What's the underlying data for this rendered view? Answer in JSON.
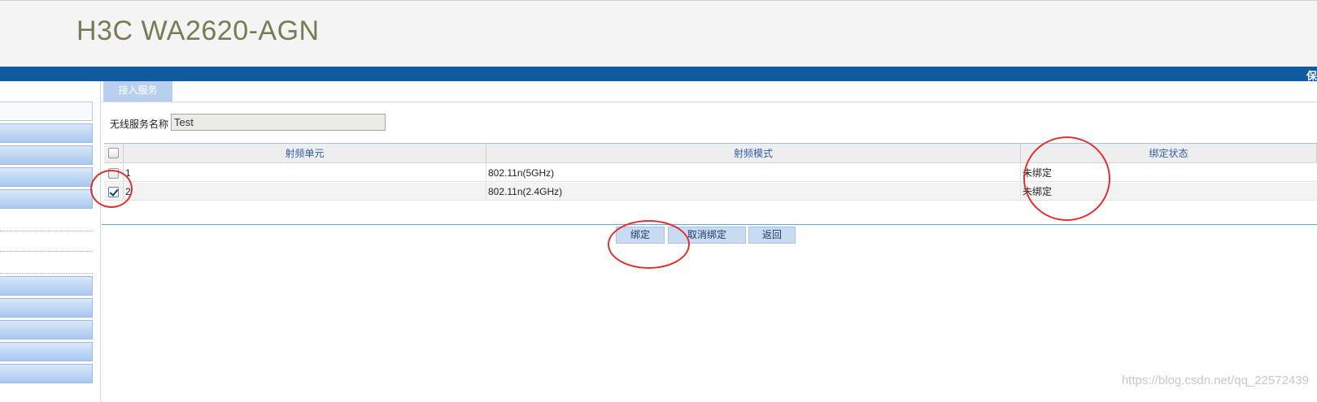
{
  "header": {
    "title": "H3C WA2620-AGN",
    "corner_text": "保"
  },
  "tabs": [
    {
      "label": "接入服务"
    }
  ],
  "service": {
    "label": "无线服务名称",
    "value": "Test"
  },
  "table": {
    "columns": [
      "射频单元",
      "射频模式",
      "绑定状态"
    ],
    "rows": [
      {
        "unit": "1",
        "mode": "802.11n(5GHz)",
        "status": "未绑定",
        "checked": false
      },
      {
        "unit": "2",
        "mode": "802.11n(2.4GHz)",
        "status": "未绑定",
        "checked": true
      }
    ]
  },
  "buttons": {
    "bind": "绑定",
    "unbind": "取消绑定",
    "back": "返回"
  },
  "watermark": "https://blog.csdn.net/qq_22572439",
  "colors": {
    "bluebar": "#125aa0",
    "annotation": "#e0302f",
    "title": "#7c7a55"
  }
}
